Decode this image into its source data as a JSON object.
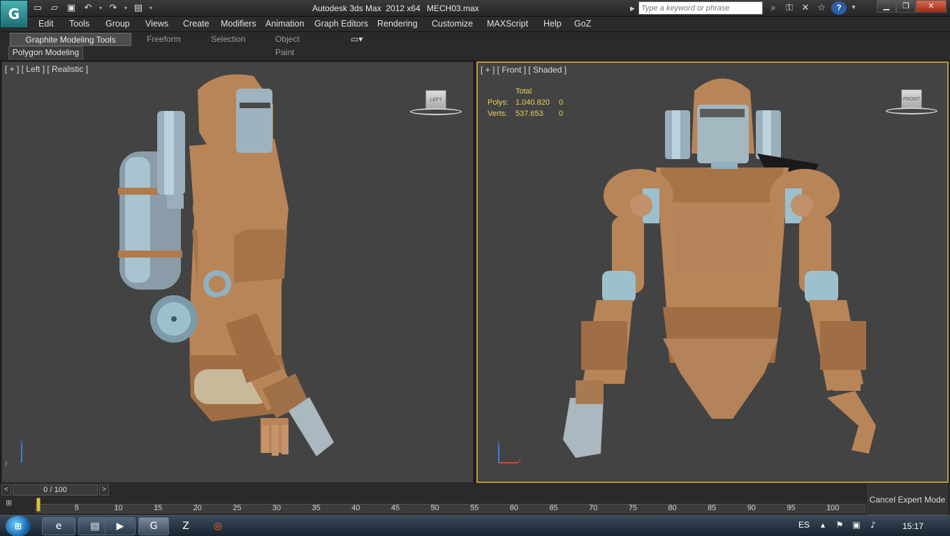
{
  "app": {
    "title": "Autodesk 3ds Max  2012 x64",
    "file": "MECH03.max",
    "logo": "G"
  },
  "quick_access": [
    "new-icon",
    "open-icon",
    "save-icon",
    "undo-icon",
    "redo-icon",
    "project-icon"
  ],
  "search": {
    "placeholder": "Type a keyword or phrase"
  },
  "menu": [
    "Edit",
    "Tools",
    "Group",
    "Views",
    "Create",
    "Modifiers",
    "Animation",
    "Graph Editors",
    "Rendering",
    "Customize",
    "MAXScript",
    "Help",
    "GoZ"
  ],
  "ribbon": {
    "tabs": [
      "Graphite Modeling Tools",
      "Freeform",
      "Selection",
      "Object Paint"
    ],
    "sub_tab": "Polygon Modeling"
  },
  "viewports": {
    "left": {
      "label": "[ + ] [ Left ] [ Realistic ]",
      "cube": "LEFT"
    },
    "front": {
      "label": "[ + ] [ Front ] [ Shaded ]",
      "cube": "FRONT"
    }
  },
  "stats": {
    "header": "Total",
    "polys_label": "Polys:",
    "polys_total": "1.040.820",
    "polys_sel": "0",
    "verts_label": "Verts:",
    "verts_total": "537.653",
    "verts_sel": "0"
  },
  "axis": {
    "z": "z",
    "x": "x",
    "y": "y"
  },
  "timeline": {
    "slider": "0 / 100",
    "prev": "<",
    "next": ">",
    "ticks": [
      "0",
      "5",
      "10",
      "15",
      "20",
      "25",
      "30",
      "35",
      "40",
      "45",
      "50",
      "55",
      "60",
      "65",
      "70",
      "75",
      "80",
      "85",
      "90",
      "95",
      "100"
    ]
  },
  "cancel_expert": "Cancel Expert Mode",
  "taskbar": {
    "lang": "ES",
    "clock": "15:17"
  },
  "colors": {
    "accent": "#b89a3a",
    "viewport_bg": "#434343",
    "model": "#b88558",
    "metal": "#9ab8c4"
  }
}
